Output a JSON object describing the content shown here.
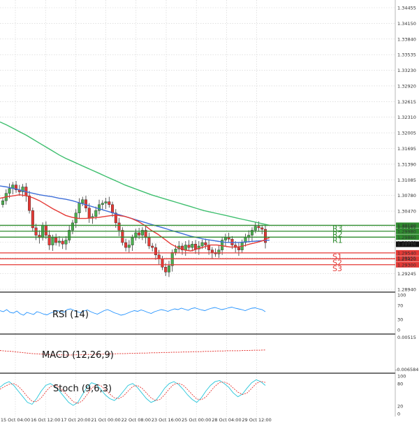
{
  "colors": {
    "bull": "#4caf50",
    "bear": "#e53935",
    "ma_fast": "#e53935",
    "ma_mid": "#3f6fd8",
    "ma_slow": "#3fbf6f",
    "resistance": "#2e8b2e",
    "support": "#e53935",
    "rsi": "#1e90ff",
    "macd": "#e53935",
    "stoch_k": "#26c6da",
    "stoch_d": "#e53935"
  },
  "chart_data": {
    "type": "candlestick",
    "ylim": [
      1.288,
      1.3462
    ],
    "price_ticks": [
      "1.34455",
      "1.34150",
      "1.33840",
      "1.33535",
      "1.33230",
      "1.32920",
      "1.32615",
      "1.32310",
      "1.32005",
      "1.31695",
      "1.31390",
      "1.31085",
      "1.30780",
      "1.30470",
      "1.30165",
      "1.29860",
      "1.29555",
      "1.29245",
      "1.28940"
    ],
    "x_labels": [
      "15 Oct 04:00",
      "16 Oct 12:00",
      "17 Oct 20:00",
      "21 Oct 00:00",
      "22 Oct 08:00",
      "23 Oct 16:00",
      "25 Oct 00:00",
      "28 Oct 04:00",
      "29 Oct 12:00"
    ],
    "current_price": "1.29716",
    "levels": [
      {
        "name": "R3",
        "value": "1.30100",
        "price": 1.301,
        "kind": "resistance"
      },
      {
        "name": "R2",
        "value": "1.29980",
        "price": 1.2998,
        "kind": "resistance"
      },
      {
        "name": "R1",
        "value": "1.29860",
        "price": 1.2986,
        "kind": "resistance"
      },
      {
        "name": "S1",
        "value": "1.29540",
        "price": 1.2954,
        "kind": "support"
      },
      {
        "name": "S2",
        "value": "1.29420",
        "price": 1.2942,
        "kind": "support"
      },
      {
        "name": "S3",
        "value": "1.29300",
        "price": 1.293,
        "kind": "support"
      }
    ],
    "candles_close": [
      1.306,
      1.3075,
      1.3085,
      1.3092,
      1.3082,
      1.3078,
      1.3088,
      1.307,
      1.304,
      1.3005,
      1.299,
      1.2985,
      1.301,
      1.299,
      1.297,
      1.2985,
      1.2975,
      1.2978,
      1.2972,
      1.298,
      1.3,
      1.3015,
      1.3035,
      1.3055,
      1.3062,
      1.3045,
      1.3025,
      1.3028,
      1.304,
      1.3052,
      1.3055,
      1.3058,
      1.3052,
      1.3035,
      1.3015,
      1.3,
      1.2975,
      1.2965,
      1.297,
      1.2985,
      1.2995,
      1.299,
      1.3,
      1.2985,
      1.2968,
      1.2965,
      1.295,
      1.2942,
      1.2925,
      1.2915,
      1.2928,
      1.2955,
      1.2962,
      1.2968,
      1.296,
      1.297,
      1.2965,
      1.2972,
      1.2962,
      1.2968,
      1.2975,
      1.297,
      1.296,
      1.2955,
      1.2952,
      1.296,
      1.298,
      1.2985,
      1.2982,
      1.297,
      1.2965,
      1.296,
      1.2975,
      1.2985,
      1.299,
      1.3,
      1.3008,
      1.3005,
      1.3002,
      1.2975
    ],
    "ma_fast": [
      1.3065,
      1.3068,
      1.307,
      1.3072,
      1.307,
      1.3066,
      1.306,
      1.3052,
      1.3044,
      1.3037,
      1.303,
      1.3026,
      1.3024,
      1.3024,
      1.3025,
      1.3026,
      1.3028,
      1.303,
      1.303,
      1.3028,
      1.3024,
      1.3018,
      1.301,
      1.3,
      1.2992,
      1.2982,
      1.2972,
      1.2965,
      1.296,
      1.2958,
      1.2962,
      1.2966,
      1.297,
      1.297,
      1.2968,
      1.2966,
      1.2966,
      1.2968,
      1.2972,
      1.2975,
      1.2979,
      1.2985
    ],
    "ma_mid": [
      1.309,
      1.3088,
      1.3085,
      1.3082,
      1.3078,
      1.3075,
      1.3072,
      1.307,
      1.3068,
      1.3065,
      1.3063,
      1.306,
      1.3056,
      1.3052,
      1.3048,
      1.3044,
      1.304,
      1.3036,
      1.3032,
      1.3028,
      1.3024,
      1.302,
      1.3016,
      1.3012,
      1.3008,
      1.3004,
      1.3,
      1.2996,
      1.2992,
      1.2988,
      1.2985,
      1.2982,
      1.298,
      1.2978,
      1.2976,
      1.2975,
      1.2975,
      1.2976,
      1.2977,
      1.2978,
      1.2979,
      1.298
    ],
    "ma_slow": [
      1.322,
      1.3214,
      1.3207,
      1.32,
      1.3193,
      1.3185,
      1.3177,
      1.3169,
      1.3161,
      1.3153,
      1.3146,
      1.314,
      1.3134,
      1.3128,
      1.3122,
      1.3116,
      1.311,
      1.3104,
      1.3098,
      1.3092,
      1.3087,
      1.3082,
      1.3077,
      1.3072,
      1.3068,
      1.3064,
      1.306,
      1.3056,
      1.3052,
      1.3048,
      1.3044,
      1.304,
      1.3037,
      1.3034,
      1.3031,
      1.3028,
      1.3025,
      1.3022,
      1.3019,
      1.3016,
      1.3013,
      1.301
    ],
    "indicators": {
      "rsi": {
        "label": "RSI (14)",
        "ylim": [
          0,
          100
        ],
        "ticks": [
          "100",
          "70",
          "30",
          "0"
        ],
        "values": [
          55,
          52,
          58,
          50,
          48,
          54,
          46,
          42,
          50,
          47,
          44,
          52,
          49,
          45,
          43,
          48,
          51,
          55,
          53,
          50,
          58,
          60,
          56,
          52,
          49,
          54,
          57,
          52,
          48,
          45,
          50,
          55,
          58,
          54,
          49,
          46,
          42,
          44,
          48,
          52,
          55,
          53,
          57,
          54,
          50,
          47,
          52,
          55,
          58,
          56,
          53,
          57,
          60,
          58,
          62,
          59,
          56,
          61,
          63,
          60,
          57,
          55,
          59,
          62,
          64,
          61,
          58,
          60,
          63,
          65,
          62,
          60,
          58,
          55,
          59,
          62,
          63,
          60,
          58,
          52
        ]
      },
      "macd": {
        "label": "MACD (12,26,9)",
        "ticks": [
          "0.00515",
          "-0.006584"
        ],
        "values": [
          0.0004,
          0.0002,
          0.0001,
          -0.0001,
          -0.0003,
          -0.0005,
          -0.0007,
          -0.0008,
          -0.0009,
          -0.001,
          -0.0011,
          -0.0011,
          -0.0012,
          -0.0012,
          -0.0011,
          -0.0011,
          -0.001,
          -0.001,
          -0.0009,
          -0.0009,
          -0.0008,
          -0.0008,
          -0.0007,
          -0.0007,
          -0.0006,
          -0.0006,
          -0.0005,
          -0.0005,
          -0.0004,
          -0.0004,
          -0.0003,
          -0.0003,
          -0.0002,
          -0.0002,
          -0.0001,
          -0.0001,
          0.0,
          0.0,
          0.0001,
          0.0001,
          0.0002,
          0.0002,
          0.0003,
          0.0003,
          0.0003,
          0.0004,
          0.0004,
          0.0005,
          0.0005,
          0.0006
        ]
      },
      "stoch": {
        "label": "Stoch (9,6,3)",
        "ticks": [
          "100",
          "80",
          "20",
          "0"
        ],
        "k": [
          70,
          80,
          85,
          75,
          60,
          45,
          30,
          25,
          40,
          60,
          75,
          80,
          72,
          60,
          45,
          30,
          22,
          30,
          50,
          70,
          82,
          78,
          65,
          50,
          40,
          35,
          45,
          60,
          75,
          80,
          70,
          55,
          40,
          30,
          35,
          50,
          68,
          80,
          85,
          78,
          65,
          50,
          38,
          30,
          42,
          60,
          75,
          85,
          88,
          80,
          70,
          55,
          45,
          52,
          68,
          82,
          90,
          85,
          75
        ],
        "d": [
          65,
          72,
          78,
          80,
          73,
          60,
          45,
          33,
          32,
          42,
          58,
          72,
          75,
          70,
          58,
          45,
          32,
          27,
          34,
          50,
          67,
          77,
          75,
          64,
          52,
          42,
          40,
          47,
          60,
          72,
          75,
          68,
          55,
          42,
          35,
          38,
          51,
          66,
          78,
          81,
          76,
          64,
          51,
          39,
          37,
          44,
          59,
          73,
          83,
          84,
          79,
          68,
          57,
          51,
          55,
          67,
          80,
          86,
          83
        ]
      }
    }
  }
}
